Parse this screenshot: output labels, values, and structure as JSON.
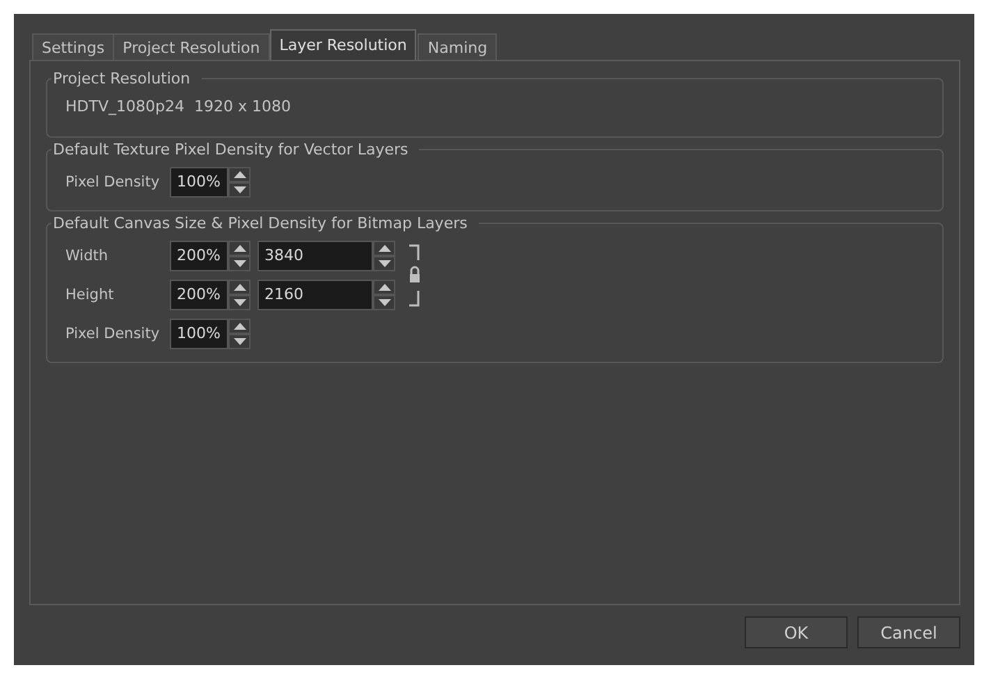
{
  "tabs": [
    {
      "label": "Settings",
      "selected": false
    },
    {
      "label": "Project Resolution",
      "selected": false
    },
    {
      "label": "Layer Resolution",
      "selected": true
    },
    {
      "label": "Naming",
      "selected": false
    }
  ],
  "groups": [
    {
      "title": "Project Resolution",
      "kind": "info",
      "text": "HDTV_1080p24  1920 x 1080"
    },
    {
      "title": "Default Texture Pixel Density for Vector Layers",
      "kind": "fields",
      "rows": [
        {
          "label": "Pixel Density",
          "fields": [
            {
              "kind": "percent",
              "value": "100%"
            }
          ]
        }
      ]
    },
    {
      "title": "Default Canvas Size & Pixel Density for Bitmap Layers",
      "kind": "fields",
      "aspect_locked": true,
      "rows": [
        {
          "label": "Width",
          "fields": [
            {
              "kind": "percent",
              "value": "200%"
            },
            {
              "kind": "number",
              "value": "3840"
            }
          ]
        },
        {
          "label": "Height",
          "fields": [
            {
              "kind": "percent",
              "value": "200%"
            },
            {
              "kind": "number",
              "value": "2160"
            }
          ]
        },
        {
          "label": "Pixel Density",
          "fields": [
            {
              "kind": "percent",
              "value": "100%"
            }
          ]
        }
      ]
    }
  ],
  "buttons": [
    "OK",
    "Cancel"
  ]
}
